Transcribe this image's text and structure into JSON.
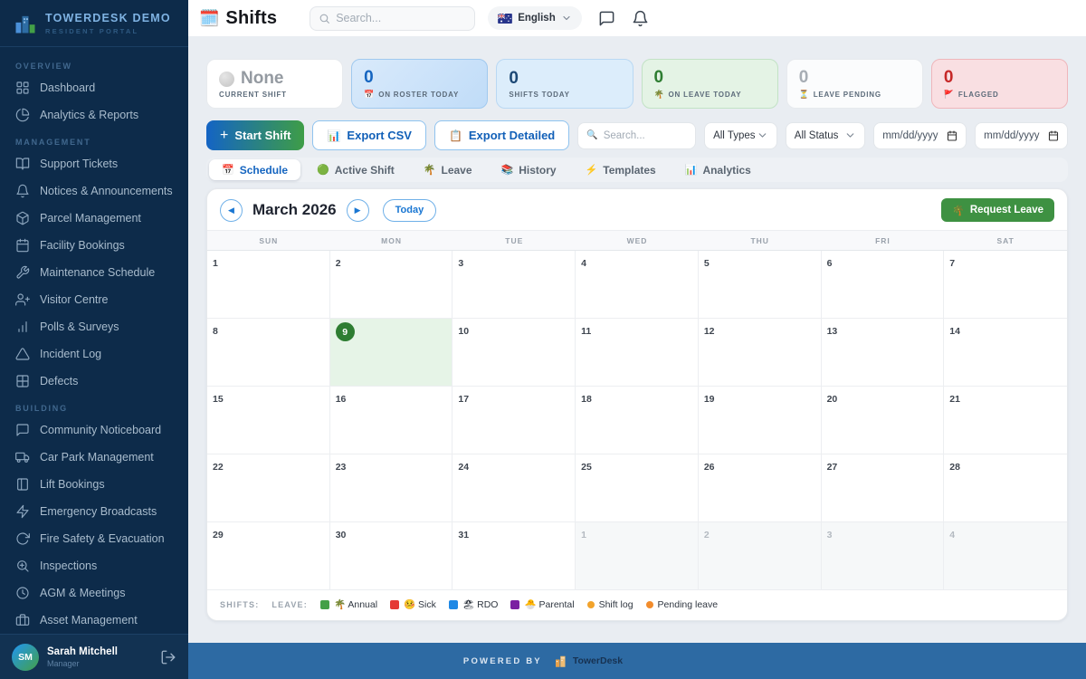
{
  "colors": {
    "accent": "#1565c0",
    "success_green": "#3e9142",
    "today_green": "#2e7d32",
    "sidebar_bg": "#0d2b4a",
    "footer_bg": "#2d6aa3"
  },
  "sidebar": {
    "brand": {
      "title": "TOWERDESK DEMO",
      "subtitle": "RESIDENT PORTAL"
    },
    "sections": [
      {
        "label": "OVERVIEW",
        "items": [
          {
            "icon": "grid",
            "label": "Dashboard"
          },
          {
            "icon": "pie-chart",
            "label": "Analytics & Reports"
          }
        ]
      },
      {
        "label": "MANAGEMENT",
        "items": [
          {
            "icon": "book-open",
            "label": "Support Tickets"
          },
          {
            "icon": "bell",
            "label": "Notices & Announcements"
          },
          {
            "icon": "package",
            "label": "Parcel Management"
          },
          {
            "icon": "calendar",
            "label": "Facility Bookings"
          },
          {
            "icon": "wrench",
            "label": "Maintenance Schedule"
          },
          {
            "icon": "user-plus",
            "label": "Visitor Centre"
          },
          {
            "icon": "bar-chart",
            "label": "Polls & Surveys"
          },
          {
            "icon": "alert-triangle",
            "label": "Incident Log"
          },
          {
            "icon": "layout-grid",
            "label": "Defects"
          }
        ]
      },
      {
        "label": "BUILDING",
        "items": [
          {
            "icon": "message-square",
            "label": "Community Noticeboard"
          },
          {
            "icon": "truck",
            "label": "Car Park Management"
          },
          {
            "icon": "door",
            "label": "Lift Bookings"
          },
          {
            "icon": "zap",
            "label": "Emergency Broadcasts"
          },
          {
            "icon": "rotate-cw",
            "label": "Fire Safety & Evacuation"
          },
          {
            "icon": "zoom-in",
            "label": "Inspections"
          },
          {
            "icon": "clock",
            "label": "AGM & Meetings"
          },
          {
            "icon": "briefcase",
            "label": "Asset Management"
          }
        ]
      }
    ],
    "user": {
      "initials": "SM",
      "name": "Sarah Mitchell",
      "role": "Manager"
    }
  },
  "header": {
    "page_icon": "🗓️",
    "title": "Shifts",
    "search_placeholder": "Search...",
    "language": "English"
  },
  "stats": [
    {
      "value": "None",
      "label": "CURRENT SHIFT",
      "icon": "",
      "variant": "neutral",
      "dot": true
    },
    {
      "value": "0",
      "label": "ON ROSTER TODAY",
      "icon": "📅",
      "variant": "blue",
      "dot": false
    },
    {
      "value": "0",
      "label": "SHIFTS TODAY",
      "icon": "",
      "variant": "blue-light",
      "dot": false
    },
    {
      "value": "0",
      "label": "ON LEAVE TODAY",
      "icon": "🌴",
      "variant": "green",
      "dot": false
    },
    {
      "value": "0",
      "label": "LEAVE PENDING",
      "icon": "⏳",
      "variant": "plain",
      "dot": false
    },
    {
      "value": "0",
      "label": "FLAGGED",
      "icon": "🚩",
      "variant": "red",
      "dot": false
    }
  ],
  "toolbar": {
    "start_shift_icon": "+",
    "start_shift_label": "Start Shift",
    "export_csv_icon": "📊",
    "export_csv_label": "Export CSV",
    "export_detailed_icon": "📋",
    "export_detailed_label": "Export Detailed"
  },
  "filters": {
    "search_icon": "🔍",
    "search_placeholder": "Search...",
    "type_selected": "All Types",
    "status_selected": "All Status",
    "date_from": "mm/dd/yyyy",
    "date_to": "mm/dd/yyyy"
  },
  "tabs": [
    {
      "icon": "📅",
      "label": "Schedule",
      "active": true
    },
    {
      "icon": "🟢",
      "label": "Active Shift",
      "active": false
    },
    {
      "icon": "🌴",
      "label": "Leave",
      "active": false
    },
    {
      "icon": "📚",
      "label": "History",
      "active": false
    },
    {
      "icon": "⚡",
      "label": "Templates",
      "active": false
    },
    {
      "icon": "📊",
      "label": "Analytics",
      "active": false
    }
  ],
  "calendar": {
    "prev_icon": "◀",
    "next_icon": "▶",
    "month_label": "March 2026",
    "today_label": "Today",
    "request_leave_icon": "🌴",
    "request_leave_label": "Request Leave",
    "day_headers": [
      "SUN",
      "MON",
      "TUE",
      "WED",
      "THU",
      "FRI",
      "SAT"
    ],
    "weeks": [
      [
        {
          "d": 1
        },
        {
          "d": 2
        },
        {
          "d": 3
        },
        {
          "d": 4
        },
        {
          "d": 5
        },
        {
          "d": 6
        },
        {
          "d": 7
        }
      ],
      [
        {
          "d": 8
        },
        {
          "d": 9,
          "today": true
        },
        {
          "d": 10
        },
        {
          "d": 11
        },
        {
          "d": 12
        },
        {
          "d": 13
        },
        {
          "d": 14
        }
      ],
      [
        {
          "d": 15
        },
        {
          "d": 16
        },
        {
          "d": 17
        },
        {
          "d": 18
        },
        {
          "d": 19
        },
        {
          "d": 20
        },
        {
          "d": 21
        }
      ],
      [
        {
          "d": 22
        },
        {
          "d": 23
        },
        {
          "d": 24
        },
        {
          "d": 25
        },
        {
          "d": 26
        },
        {
          "d": 27
        },
        {
          "d": 28
        }
      ],
      [
        {
          "d": 29
        },
        {
          "d": 30
        },
        {
          "d": 31
        },
        {
          "d": 1,
          "out": true
        },
        {
          "d": 2,
          "out": true
        },
        {
          "d": 3,
          "out": true
        },
        {
          "d": 4,
          "out": true
        }
      ]
    ],
    "legend": {
      "shifts_label": "SHIFTS:",
      "leave_label": "LEAVE:",
      "items": [
        {
          "color": "#43a047",
          "shape": "square",
          "icon": "🌴",
          "label": "Annual"
        },
        {
          "color": "#e53935",
          "shape": "square",
          "icon": "🤒",
          "label": "Sick"
        },
        {
          "color": "#1e88e5",
          "shape": "square",
          "icon": "🏖",
          "label": "RDO"
        },
        {
          "color": "#7b1fa2",
          "shape": "square",
          "icon": "🐣",
          "label": "Parental"
        },
        {
          "color": "#f2a32c",
          "shape": "dot",
          "icon": "",
          "label": "Shift log"
        },
        {
          "color": "#f28c2c",
          "shape": "dot",
          "icon": "",
          "label": "Pending leave"
        }
      ]
    }
  },
  "footer": {
    "powered_by": "POWERED BY",
    "brand": "TowerDesk"
  }
}
